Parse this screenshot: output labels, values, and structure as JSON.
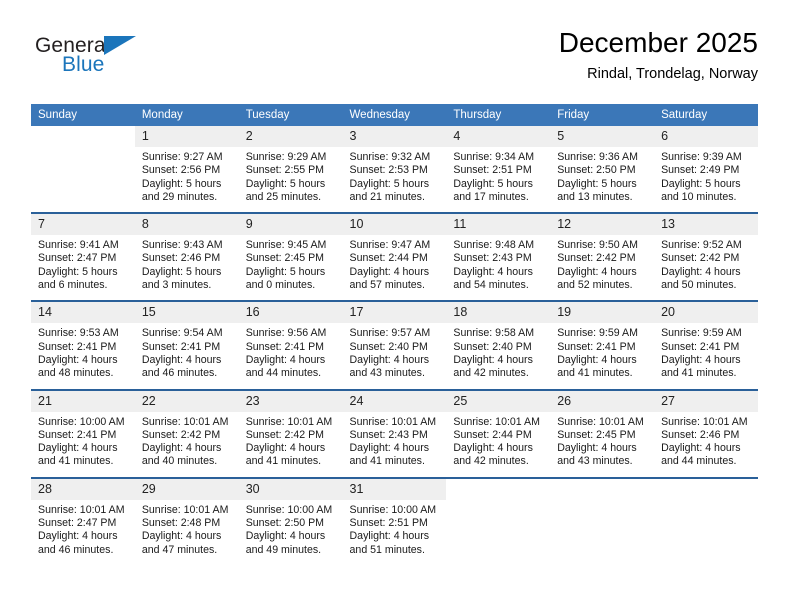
{
  "brand": {
    "name_part1": "General",
    "name_part2": "Blue",
    "accent_color": "#1b75bb",
    "triangle_icon": "triangle-icon"
  },
  "header": {
    "title": "December 2025",
    "location": "Rindal, Trondelag, Norway"
  },
  "calendar": {
    "header_bg": "#3b77b8",
    "daynum_bg": "#efefef",
    "separator_color": "#2a6099",
    "weekdays": [
      "Sunday",
      "Monday",
      "Tuesday",
      "Wednesday",
      "Thursday",
      "Friday",
      "Saturday"
    ],
    "weeks": [
      [
        {
          "day": "",
          "lines": []
        },
        {
          "day": "1",
          "lines": [
            "Sunrise: 9:27 AM",
            "Sunset: 2:56 PM",
            "Daylight: 5 hours",
            "and 29 minutes."
          ]
        },
        {
          "day": "2",
          "lines": [
            "Sunrise: 9:29 AM",
            "Sunset: 2:55 PM",
            "Daylight: 5 hours",
            "and 25 minutes."
          ]
        },
        {
          "day": "3",
          "lines": [
            "Sunrise: 9:32 AM",
            "Sunset: 2:53 PM",
            "Daylight: 5 hours",
            "and 21 minutes."
          ]
        },
        {
          "day": "4",
          "lines": [
            "Sunrise: 9:34 AM",
            "Sunset: 2:51 PM",
            "Daylight: 5 hours",
            "and 17 minutes."
          ]
        },
        {
          "day": "5",
          "lines": [
            "Sunrise: 9:36 AM",
            "Sunset: 2:50 PM",
            "Daylight: 5 hours",
            "and 13 minutes."
          ]
        },
        {
          "day": "6",
          "lines": [
            "Sunrise: 9:39 AM",
            "Sunset: 2:49 PM",
            "Daylight: 5 hours",
            "and 10 minutes."
          ]
        }
      ],
      [
        {
          "day": "7",
          "lines": [
            "Sunrise: 9:41 AM",
            "Sunset: 2:47 PM",
            "Daylight: 5 hours",
            "and 6 minutes."
          ]
        },
        {
          "day": "8",
          "lines": [
            "Sunrise: 9:43 AM",
            "Sunset: 2:46 PM",
            "Daylight: 5 hours",
            "and 3 minutes."
          ]
        },
        {
          "day": "9",
          "lines": [
            "Sunrise: 9:45 AM",
            "Sunset: 2:45 PM",
            "Daylight: 5 hours",
            "and 0 minutes."
          ]
        },
        {
          "day": "10",
          "lines": [
            "Sunrise: 9:47 AM",
            "Sunset: 2:44 PM",
            "Daylight: 4 hours",
            "and 57 minutes."
          ]
        },
        {
          "day": "11",
          "lines": [
            "Sunrise: 9:48 AM",
            "Sunset: 2:43 PM",
            "Daylight: 4 hours",
            "and 54 minutes."
          ]
        },
        {
          "day": "12",
          "lines": [
            "Sunrise: 9:50 AM",
            "Sunset: 2:42 PM",
            "Daylight: 4 hours",
            "and 52 minutes."
          ]
        },
        {
          "day": "13",
          "lines": [
            "Sunrise: 9:52 AM",
            "Sunset: 2:42 PM",
            "Daylight: 4 hours",
            "and 50 minutes."
          ]
        }
      ],
      [
        {
          "day": "14",
          "lines": [
            "Sunrise: 9:53 AM",
            "Sunset: 2:41 PM",
            "Daylight: 4 hours",
            "and 48 minutes."
          ]
        },
        {
          "day": "15",
          "lines": [
            "Sunrise: 9:54 AM",
            "Sunset: 2:41 PM",
            "Daylight: 4 hours",
            "and 46 minutes."
          ]
        },
        {
          "day": "16",
          "lines": [
            "Sunrise: 9:56 AM",
            "Sunset: 2:41 PM",
            "Daylight: 4 hours",
            "and 44 minutes."
          ]
        },
        {
          "day": "17",
          "lines": [
            "Sunrise: 9:57 AM",
            "Sunset: 2:40 PM",
            "Daylight: 4 hours",
            "and 43 minutes."
          ]
        },
        {
          "day": "18",
          "lines": [
            "Sunrise: 9:58 AM",
            "Sunset: 2:40 PM",
            "Daylight: 4 hours",
            "and 42 minutes."
          ]
        },
        {
          "day": "19",
          "lines": [
            "Sunrise: 9:59 AM",
            "Sunset: 2:41 PM",
            "Daylight: 4 hours",
            "and 41 minutes."
          ]
        },
        {
          "day": "20",
          "lines": [
            "Sunrise: 9:59 AM",
            "Sunset: 2:41 PM",
            "Daylight: 4 hours",
            "and 41 minutes."
          ]
        }
      ],
      [
        {
          "day": "21",
          "lines": [
            "Sunrise: 10:00 AM",
            "Sunset: 2:41 PM",
            "Daylight: 4 hours",
            "and 41 minutes."
          ]
        },
        {
          "day": "22",
          "lines": [
            "Sunrise: 10:01 AM",
            "Sunset: 2:42 PM",
            "Daylight: 4 hours",
            "and 40 minutes."
          ]
        },
        {
          "day": "23",
          "lines": [
            "Sunrise: 10:01 AM",
            "Sunset: 2:42 PM",
            "Daylight: 4 hours",
            "and 41 minutes."
          ]
        },
        {
          "day": "24",
          "lines": [
            "Sunrise: 10:01 AM",
            "Sunset: 2:43 PM",
            "Daylight: 4 hours",
            "and 41 minutes."
          ]
        },
        {
          "day": "25",
          "lines": [
            "Sunrise: 10:01 AM",
            "Sunset: 2:44 PM",
            "Daylight: 4 hours",
            "and 42 minutes."
          ]
        },
        {
          "day": "26",
          "lines": [
            "Sunrise: 10:01 AM",
            "Sunset: 2:45 PM",
            "Daylight: 4 hours",
            "and 43 minutes."
          ]
        },
        {
          "day": "27",
          "lines": [
            "Sunrise: 10:01 AM",
            "Sunset: 2:46 PM",
            "Daylight: 4 hours",
            "and 44 minutes."
          ]
        }
      ],
      [
        {
          "day": "28",
          "lines": [
            "Sunrise: 10:01 AM",
            "Sunset: 2:47 PM",
            "Daylight: 4 hours",
            "and 46 minutes."
          ]
        },
        {
          "day": "29",
          "lines": [
            "Sunrise: 10:01 AM",
            "Sunset: 2:48 PM",
            "Daylight: 4 hours",
            "and 47 minutes."
          ]
        },
        {
          "day": "30",
          "lines": [
            "Sunrise: 10:00 AM",
            "Sunset: 2:50 PM",
            "Daylight: 4 hours",
            "and 49 minutes."
          ]
        },
        {
          "day": "31",
          "lines": [
            "Sunrise: 10:00 AM",
            "Sunset: 2:51 PM",
            "Daylight: 4 hours",
            "and 51 minutes."
          ]
        },
        {
          "day": "",
          "lines": []
        },
        {
          "day": "",
          "lines": []
        },
        {
          "day": "",
          "lines": []
        }
      ]
    ]
  }
}
